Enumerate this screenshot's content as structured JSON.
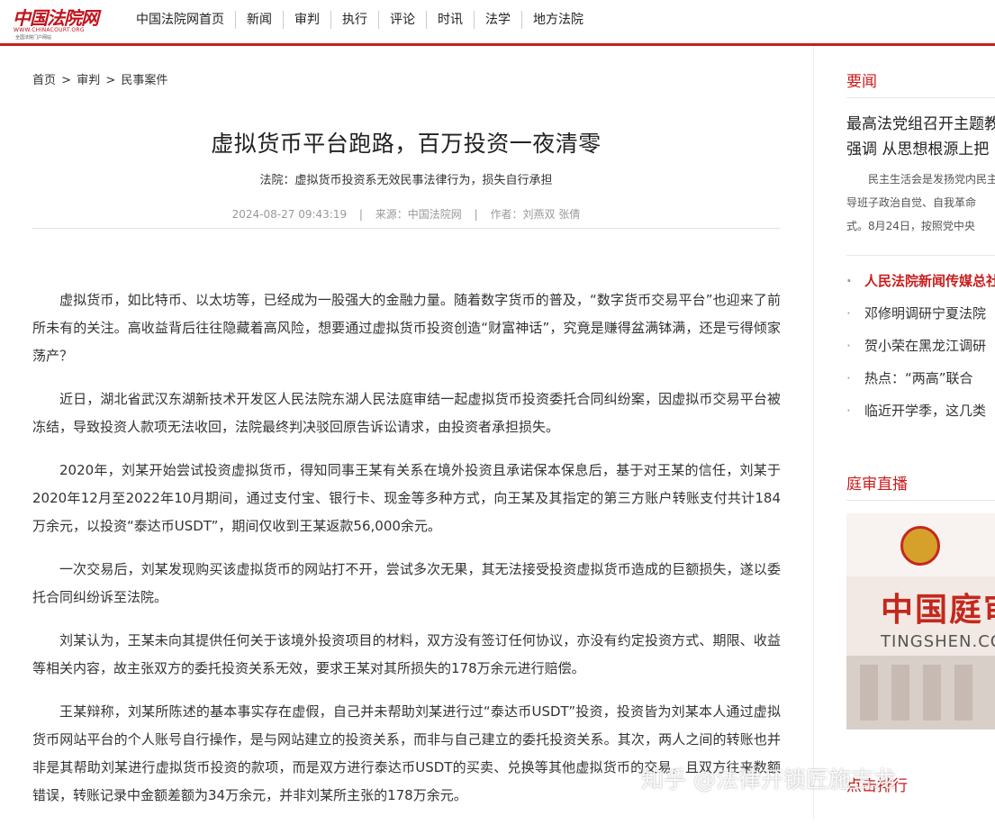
{
  "logo": {
    "main": "中国法院网",
    "sub1": "WWW.CHINACOURT.ORG",
    "sub2": "全国法院门户网站"
  },
  "nav": [
    "中国法院网首页",
    "新闻",
    "审判",
    "执行",
    "评论",
    "时讯",
    "法学",
    "地方法院"
  ],
  "breadcrumb": {
    "home": "首页",
    "sep": ">",
    "level2": "审判",
    "level3": "民事案件"
  },
  "article": {
    "title": "虚拟货币平台跑路，百万投资一夜清零",
    "subtitle": "法院：虚拟货币投资系无效民事法律行为，损失自行承担",
    "datetime": "2024-08-27 09:43:19",
    "source": "来源：中国法院网",
    "author": "作者：刘燕双 张倩",
    "separator": "|",
    "paragraphs": [
      "虚拟货币，如比特币、以太坊等，已经成为一股强大的金融力量。随着数字货币的普及，“数字货币交易平台”也迎来了前所未有的关注。高收益背后往往隐藏着高风险，想要通过虚拟货币投资创造“财富神话”，究竟是赚得盆满钵满，还是亏得倾家荡产？",
      "近日，湖北省武汉东湖新技术开发区人民法院东湖人民法庭审结一起虚拟货币投资委托合同纠纷案，因虚拟币交易平台被冻结，导致投资人款项无法收回，法院最终判决驳回原告诉讼请求，由投资者承担损失。",
      "2020年，刘某开始尝试投资虚拟货币，得知同事王某有关系在境外投资且承诺保本保息后，基于对王某的信任，刘某于2020年12月至2022年10月期间，通过支付宝、银行卡、现金等多种方式，向王某及其指定的第三方账户转账支付共计184万余元，以投资“泰达币USDT”，期间仅收到王某返款56,000余元。",
      "一次交易后，刘某发现购买该虚拟货币的网站打不开，尝试多次无果，其无法接受投资虚拟货币造成的巨额损失，遂以委托合同纠纷诉至法院。",
      "刘某认为，王某未向其提供任何关于该境外投资项目的材料，双方没有签订任何协议，亦没有约定投资方式、期限、收益等相关内容，故主张双方的委托投资关系无效，要求王某对其所损失的178万余元进行赔偿。",
      "王某辩称，刘某所陈述的基本事实存在虚假，自己并未帮助刘某进行过“泰达币USDT”投资，投资皆为刘某本人通过虚拟货币网站平台的个人账号自行操作，是与网站建立的投资关系，而非与自己建立的委托投资关系。其次，两人之间的转账也并非是其帮助刘某进行虚拟货币投资的款项，而是双方进行泰达币USDT的买卖、兑换等其他虚拟货币的交易，且双方往来数额错误，转账记录中金额差额为34万余元，并非刘某所主张的178万余元。"
    ]
  },
  "sidebar": {
    "section1_title": "要闻",
    "headline": [
      "最高法党组召开主题教育专题民主生活会",
      "强调 从思想根源上把"
    ],
    "summary": [
      "民主生活会是发扬党内民主、加强党内监督的重要方式",
      "导班子政治自觉、自我革命",
      "式。8月24日，按照党中央"
    ],
    "news": [
      "人民法院新闻传媒总社",
      "邓修明调研宁夏法院",
      "贺小荣在黑龙江调研",
      "热点：“两高”联合",
      "临近开学季，这几类"
    ],
    "section2_title": "庭审直播",
    "tingshen_name": "中国庭审公开网",
    "tingshen_url": "TINGSHEN.COURT.GOV.CN",
    "section3_title": "点击排行",
    "watermark": "知乎 @法律开锁匠施吉龙"
  },
  "colors": {
    "brand": "#c81e1e",
    "text": "#333333",
    "meta": "#999999"
  }
}
